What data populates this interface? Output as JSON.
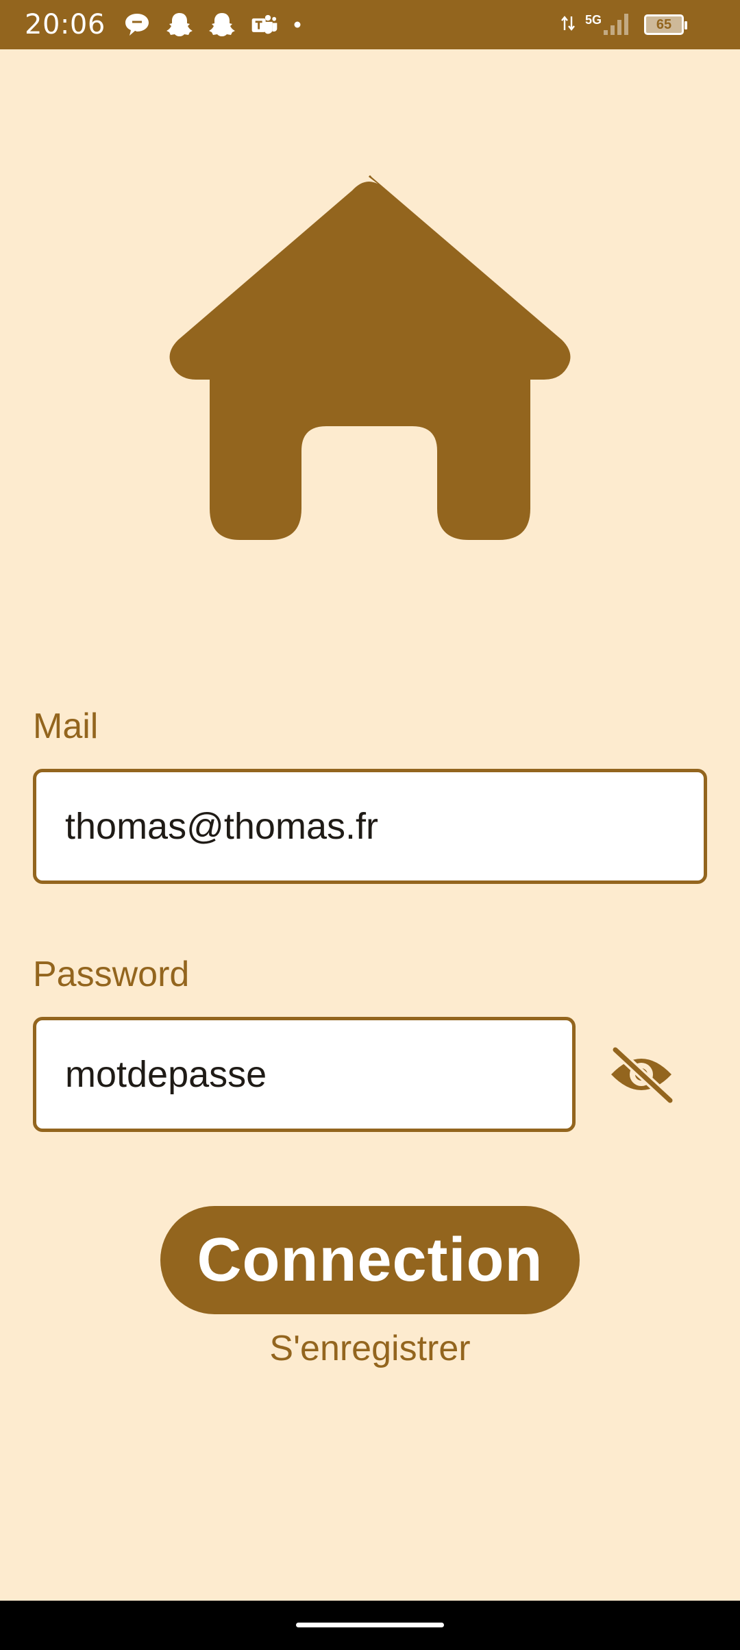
{
  "status_bar": {
    "time": "20:06",
    "notification_icons": [
      "chat-bubble-icon",
      "snapchat-icon",
      "snapchat-icon",
      "teams-icon"
    ],
    "network": "5G",
    "battery_level": "65"
  },
  "logo": {
    "icon": "house-icon",
    "color": "#93651E"
  },
  "form": {
    "mail_label": "Mail",
    "mail_value": "thomas@thomas.fr",
    "password_label": "Password",
    "password_value": "motdepasse",
    "visibility_icon": "eye-off-icon",
    "connect_label": "Connection",
    "register_label": "S'enregistrer"
  },
  "colors": {
    "accent": "#93651E",
    "background": "#FDEBCF",
    "field_background": "#FFFFFF"
  }
}
